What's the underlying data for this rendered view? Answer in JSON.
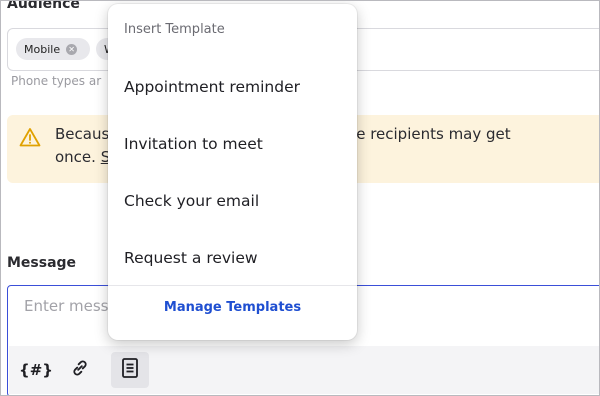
{
  "audience": {
    "label": "Audience",
    "chips": [
      {
        "label": "Mobile",
        "remove_icon": "close-circle-icon"
      },
      {
        "label": "W"
      }
    ],
    "hint": "Phone types ar"
  },
  "warning": {
    "icon": "warning-triangle-icon",
    "line1_start": "Because",
    "line1_end": "added, some recipients may get",
    "line2_start": "once.",
    "line2_link": "S",
    "background": "#fdf3dd",
    "icon_color": "#e0a100"
  },
  "message": {
    "label": "Message",
    "placeholder": "Enter mess",
    "border_color": "#3b4fd8",
    "toolbar": {
      "variable_button": "{#}",
      "link_icon": "link-icon",
      "template_icon": "document-icon"
    }
  },
  "template_menu": {
    "header": "Insert Template",
    "items": [
      "Appointment reminder",
      "Invitation to meet",
      "Check your email",
      "Request a review"
    ],
    "manage_label": "Manage Templates",
    "link_color": "#1f4fd1"
  }
}
